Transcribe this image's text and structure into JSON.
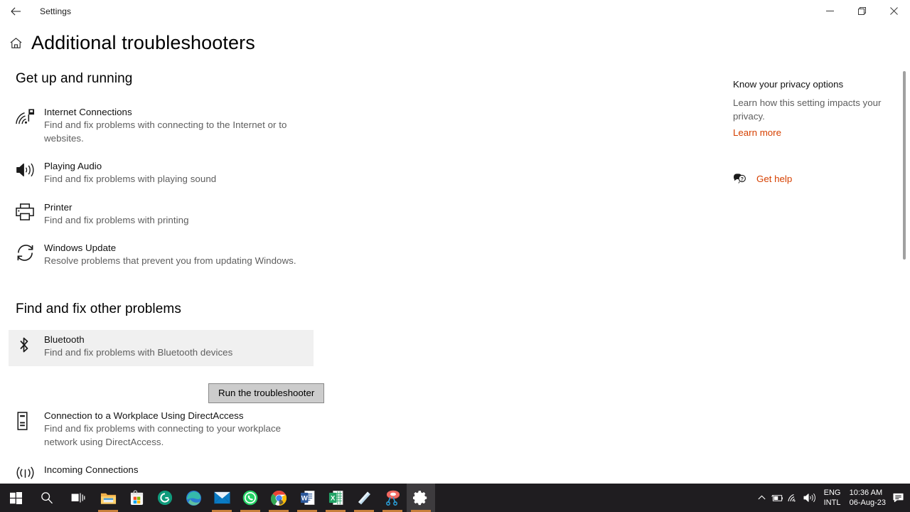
{
  "titlebar": {
    "back_label": "back-arrow",
    "app_title": "Settings",
    "minimize": "minimize",
    "restore": "restore",
    "close": "close"
  },
  "header": {
    "home_icon": "home-icon",
    "title": "Additional troubleshooters"
  },
  "sections": [
    {
      "title": "Get up and running",
      "items": [
        {
          "icon": "internet-connections-icon",
          "name": "Internet Connections",
          "desc": "Find and fix problems with connecting to the Internet or to websites."
        },
        {
          "icon": "speaker-icon",
          "name": "Playing Audio",
          "desc": "Find and fix problems with playing sound"
        },
        {
          "icon": "printer-icon",
          "name": "Printer",
          "desc": "Find and fix problems with printing"
        },
        {
          "icon": "refresh-icon",
          "name": "Windows Update",
          "desc": "Resolve problems that prevent you from updating Windows."
        }
      ]
    },
    {
      "title": "Find and fix other problems",
      "items": [
        {
          "icon": "bluetooth-icon",
          "name": "Bluetooth",
          "desc": "Find and fix problems with Bluetooth devices",
          "selected": true,
          "button": "Run the troubleshooter"
        },
        {
          "icon": "device-icon",
          "name": "Connection to a Workplace Using DirectAccess",
          "desc": "Find and fix problems with connecting to your workplace network using DirectAccess."
        },
        {
          "icon": "broadcast-icon",
          "name": "Incoming Connections",
          "desc": ""
        }
      ]
    }
  ],
  "right_panel": {
    "privacy_title": "Know your privacy options",
    "privacy_desc": "Learn how this setting impacts your privacy.",
    "learn_more": "Learn more",
    "help_icon": "help-chat-icon",
    "get_help": "Get help",
    "link_color": "#d64000"
  },
  "taskbar": {
    "start": "windows-start-icon",
    "search": "search-icon",
    "taskview": "task-view-icon",
    "apps": [
      {
        "icon": "file-explorer-icon",
        "name": "File Explorer",
        "running": true
      },
      {
        "icon": "microsoft-store-icon",
        "name": "Microsoft Store",
        "running": false
      },
      {
        "icon": "grammarly-icon",
        "name": "Grammarly",
        "running": false
      },
      {
        "icon": "microsoft-edge-icon",
        "name": "Microsoft Edge",
        "running": false
      },
      {
        "icon": "mail-icon",
        "name": "Mail",
        "running": true
      },
      {
        "icon": "whatsapp-icon",
        "name": "WhatsApp",
        "running": true
      },
      {
        "icon": "google-chrome-icon",
        "name": "Google Chrome",
        "running": true
      },
      {
        "icon": "word-icon",
        "name": "Microsoft Word",
        "running": true
      },
      {
        "icon": "excel-icon",
        "name": "Microsoft Excel",
        "running": true
      },
      {
        "icon": "sticky-notes-icon",
        "name": "Sticky Notes",
        "running": true
      },
      {
        "icon": "snipping-tool-icon",
        "name": "Snipping Tool",
        "running": true
      },
      {
        "icon": "settings-gear-icon",
        "name": "Settings",
        "running": true,
        "active": true
      }
    ],
    "tray": {
      "chevron": "chevron-up-icon",
      "battery": "battery-icon",
      "network": "wifi-icon",
      "volume": "volume-icon",
      "lang_line1": "ENG",
      "lang_line2": "INTL",
      "time": "10:36 AM",
      "date": "06-Aug-23",
      "notifications": "notification-icon"
    }
  }
}
